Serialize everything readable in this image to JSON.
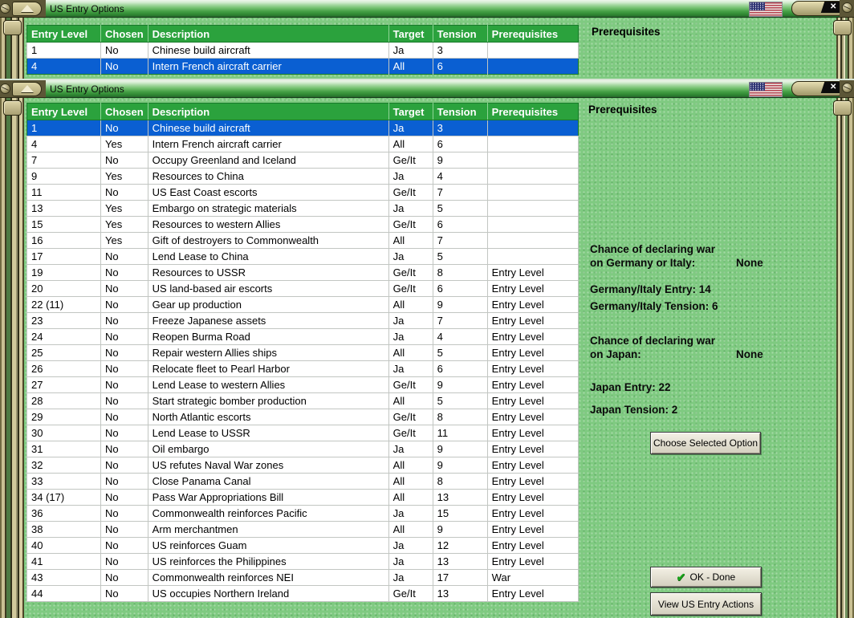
{
  "colors": {
    "selection_blue": "#0a5fd2",
    "header_green": "#2ba23d",
    "background_green": "#7fca81",
    "frame_khaki": "#c9c093"
  },
  "icons": {
    "close": "✕",
    "collapse": "triangle-up",
    "ok_check": "✔",
    "flag": "us-flag"
  },
  "columns": {
    "headers": [
      "Entry Level",
      "Chosen",
      "Description",
      "Target",
      "Tension",
      "Prerequisites"
    ],
    "fields": [
      "entry-level",
      "chosen",
      "description",
      "target",
      "tension",
      "prerequisites"
    ]
  },
  "win_top": {
    "title": "US Entry Options",
    "prerequisites_label": "Prerequisites",
    "selected_row": 1,
    "rows": [
      [
        "1",
        "No",
        "Chinese build aircraft",
        "Ja",
        "3",
        ""
      ],
      [
        "4",
        "No",
        "Intern French aircraft carrier",
        "All",
        "6",
        ""
      ]
    ]
  },
  "win_main": {
    "title": "US Entry Options",
    "prerequisites_label": "Prerequisites",
    "selected_row": 0,
    "rows": [
      [
        "1",
        "No",
        "Chinese build aircraft",
        "Ja",
        "3",
        ""
      ],
      [
        "4",
        "Yes",
        "Intern French aircraft carrier",
        "All",
        "6",
        ""
      ],
      [
        "7",
        "No",
        "Occupy Greenland and Iceland",
        "Ge/It",
        "9",
        ""
      ],
      [
        "9",
        "Yes",
        "Resources to China",
        "Ja",
        "4",
        ""
      ],
      [
        "11",
        "No",
        "US East Coast escorts",
        "Ge/It",
        "7",
        ""
      ],
      [
        "13",
        "Yes",
        "Embargo on strategic materials",
        "Ja",
        "5",
        ""
      ],
      [
        "15",
        "Yes",
        "Resources to western Allies",
        "Ge/It",
        "6",
        ""
      ],
      [
        "16",
        "Yes",
        "Gift of destroyers to Commonwealth",
        "All",
        "7",
        ""
      ],
      [
        "17",
        "No",
        "Lend Lease to China",
        "Ja",
        "5",
        ""
      ],
      [
        "19",
        "No",
        "Resources to USSR",
        "Ge/It",
        "8",
        "Entry Level"
      ],
      [
        "20",
        "No",
        "US land-based air escorts",
        "Ge/It",
        "6",
        "Entry Level"
      ],
      [
        "22 (11)",
        "No",
        "Gear up production",
        "All",
        "9",
        "Entry Level"
      ],
      [
        "23",
        "No",
        "Freeze Japanese assets",
        "Ja",
        "7",
        "Entry Level"
      ],
      [
        "24",
        "No",
        "Reopen Burma Road",
        "Ja",
        "4",
        "Entry Level"
      ],
      [
        "25",
        "No",
        "Repair western Allies ships",
        "All",
        "5",
        "Entry Level"
      ],
      [
        "26",
        "No",
        "Relocate fleet to Pearl Harbor",
        "Ja",
        "6",
        "Entry Level"
      ],
      [
        "27",
        "No",
        "Lend Lease to western Allies",
        "Ge/It",
        "9",
        "Entry Level"
      ],
      [
        "28",
        "No",
        "Start strategic bomber production",
        "All",
        "5",
        "Entry Level"
      ],
      [
        "29",
        "No",
        "North Atlantic escorts",
        "Ge/It",
        "8",
        "Entry Level"
      ],
      [
        "30",
        "No",
        "Lend Lease to USSR",
        "Ge/It",
        "11",
        "Entry Level"
      ],
      [
        "31",
        "No",
        "Oil embargo",
        "Ja",
        "9",
        "Entry Level"
      ],
      [
        "32",
        "No",
        "US refutes Naval War zones",
        "All",
        "9",
        "Entry Level"
      ],
      [
        "33",
        "No",
        "Close Panama Canal",
        "All",
        "8",
        "Entry Level"
      ],
      [
        "34 (17)",
        "No",
        "Pass War Appropriations Bill",
        "All",
        "13",
        "Entry Level"
      ],
      [
        "36",
        "No",
        "Commonwealth reinforces Pacific",
        "Ja",
        "15",
        "Entry Level"
      ],
      [
        "38",
        "No",
        "Arm merchantmen",
        "All",
        "9",
        "Entry Level"
      ],
      [
        "40",
        "No",
        "US reinforces Guam",
        "Ja",
        "12",
        "Entry Level"
      ],
      [
        "41",
        "No",
        "US reinforces the Philippines",
        "Ja",
        "13",
        "Entry Level"
      ],
      [
        "43",
        "No",
        "Commonwealth reinforces NEI",
        "Ja",
        "17",
        "War"
      ],
      [
        "44",
        "No",
        "US occupies Northern Ireland",
        "Ge/It",
        "13",
        "Entry Level"
      ]
    ],
    "stats": {
      "chance_germany_line1": "Chance of declaring war",
      "chance_germany_line2": "on Germany or Italy:",
      "chance_germany_value": "None",
      "germany_entry": "Germany/Italy Entry: 14",
      "germany_tension": "Germany/Italy Tension: 6",
      "chance_japan_line1": "Chance of declaring war",
      "chance_japan_line2": "on Japan:",
      "chance_japan_value": "None",
      "japan_entry": "Japan Entry: 22",
      "japan_tension": "Japan Tension: 2"
    },
    "buttons": {
      "choose": "Choose Selected Option",
      "ok": "OK - Done",
      "view": "View US Entry Actions"
    }
  }
}
